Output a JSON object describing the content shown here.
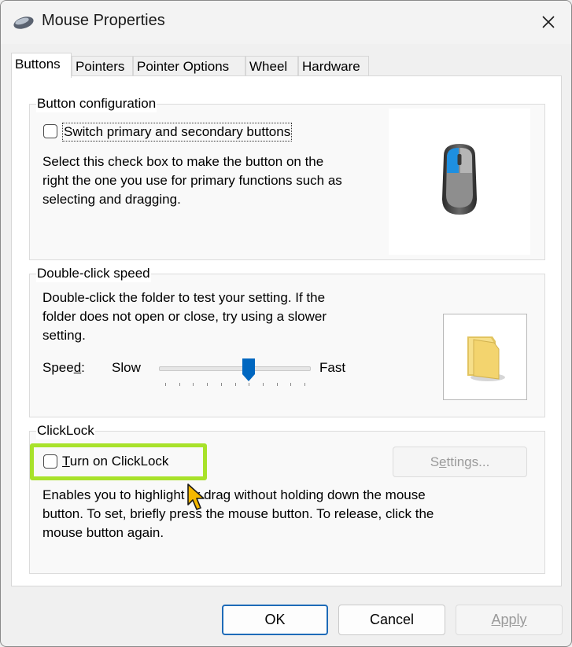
{
  "window": {
    "title": "Mouse Properties",
    "close_icon": "close-icon"
  },
  "tabs": [
    {
      "label": "Buttons",
      "active": true
    },
    {
      "label": "Pointers",
      "active": false
    },
    {
      "label": "Pointer Options",
      "active": false
    },
    {
      "label": "Wheel",
      "active": false
    },
    {
      "label": "Hardware",
      "active": false
    }
  ],
  "button_configuration": {
    "group_label": "Button configuration",
    "checkbox_label": "Switch primary and secondary buttons",
    "checked": false,
    "description_lines": [
      "Select this check box to make the button on the",
      "right the one you use for primary functions such as",
      "selecting and dragging."
    ]
  },
  "double_click_speed": {
    "group_label": "Double-click speed",
    "description_lines": [
      "Double-click the folder to test your setting. If the",
      "folder does not open or close, try using a slower",
      "setting."
    ],
    "speed_label_pre": "Spee",
    "speed_label_u": "d",
    "speed_label_post": ":",
    "slow_label": "Slow",
    "fast_label": "Fast",
    "slider_value_fraction": 0.6
  },
  "clicklock": {
    "group_label": "ClickLock",
    "checkbox_label_u": "T",
    "checkbox_label_rest": "urn on ClickLock",
    "checked": false,
    "settings_button_pre": "S",
    "settings_button_u": "e",
    "settings_button_post": "ttings...",
    "description_lines": [
      "Enables you to highlight or drag without holding down the mouse",
      "button. To set, briefly press the mouse button. To release, click the",
      "mouse button again."
    ]
  },
  "footer": {
    "ok_label": "OK",
    "cancel_label": "Cancel",
    "apply_label": "Apply"
  },
  "colors": {
    "highlight": "#a8e22a",
    "accent": "#0067c0",
    "cursor": "#f5b800"
  }
}
